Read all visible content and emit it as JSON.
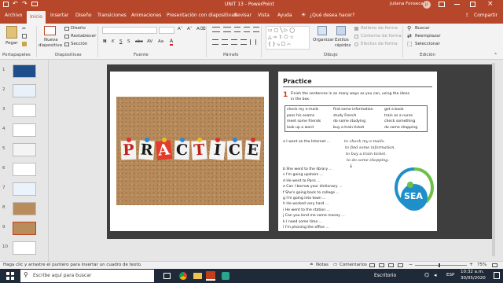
{
  "window": {
    "title": "UNIT 13 - PowerPoint",
    "user": "Juliana Fonseca",
    "user_initials": "JF"
  },
  "tabs": [
    {
      "label": "Archivo"
    },
    {
      "label": "Inicio",
      "active": true
    },
    {
      "label": "Insertar"
    },
    {
      "label": "Diseño"
    },
    {
      "label": "Transiciones"
    },
    {
      "label": "Animaciones"
    },
    {
      "label": "Presentación con diapositivas"
    },
    {
      "label": "Revisar"
    },
    {
      "label": "Vista"
    },
    {
      "label": "Ayuda"
    },
    {
      "label": "¿Qué desea hacer?"
    }
  ],
  "share_label": "Compartir",
  "ribbon": {
    "clipboard": {
      "paste": "Pegar",
      "group": "Portapapeles"
    },
    "slides": {
      "new_slide_1": "Nueva",
      "new_slide_2": "diapositiva",
      "layout": "Diseño",
      "reset": "Restablecer",
      "section": "Sección",
      "group": "Diapositivas"
    },
    "font": {
      "group": "Fuente"
    },
    "paragraph": {
      "group": "Párrafo"
    },
    "drawing": {
      "arrange": "Organizar",
      "quick_styles_1": "Estilos",
      "quick_styles_2": "rápidos",
      "shape_fill": "Relleno de forma",
      "shape_outline": "Contorno de forma",
      "shape_effects": "Efectos de forma",
      "group": "Dibujo"
    },
    "editing": {
      "find": "Buscar",
      "replace": "Reemplazar",
      "select": "Seleccionar",
      "group": "Edición"
    }
  },
  "thumbnails": [
    {
      "number": "1"
    },
    {
      "number": "2"
    },
    {
      "number": "3"
    },
    {
      "number": "4"
    },
    {
      "number": "5"
    },
    {
      "number": "6"
    },
    {
      "number": "7"
    },
    {
      "number": "8"
    },
    {
      "number": "9",
      "selected": true
    },
    {
      "number": "10"
    }
  ],
  "slide": {
    "left_image_word": [
      "P",
      "R",
      "A",
      "C",
      "T",
      "I",
      "C",
      "E"
    ],
    "practice_title": "Practice",
    "exercise_number": "1",
    "instruction_1": "Finish the sentences in as many ways as you can, using the ideas",
    "instruction_2": "in the box.",
    "box": [
      [
        "check my e-mails",
        "find some information",
        "get a book"
      ],
      [
        "pass his exams",
        "study French",
        "train as a nurse"
      ],
      [
        "meet some friends",
        "do some studying",
        "check something"
      ],
      [
        "look up a word",
        "buy a train ticket",
        "do some shopping"
      ]
    ],
    "item_a": "a  I went on the Internet ...",
    "handwriting": [
      "to check my e-mails.",
      "to find some information.",
      "to buy a train ticket.",
      "to do some shopping."
    ],
    "sentences": [
      "b  She went to the library ...",
      "c  I'm going upstairs ...",
      "d  He went to Paris ...",
      "e  Can I borrow your dictionary ...",
      "f  She's going back to college ...",
      "g  I'm going into town ...",
      "h  He worked very hard ...",
      "i  He went to the station ...",
      "j  Can you lend me some money ...",
      "k  I need some time ...",
      "l  I'm phoning the office ..."
    ],
    "logo_text": "SEA"
  },
  "statusbar": {
    "hint": "Haga clic y arrastre el puntero para insertar un cuadro de texto.",
    "notes": "Notas",
    "comments": "Comentarios",
    "zoom": "75%"
  },
  "taskbar": {
    "search_placeholder": "Escribe aquí para buscar",
    "desktop": "Escritorio",
    "language": "ESP",
    "time": "10:32 a.m.",
    "date": "30/05/2020"
  },
  "colors": {
    "brand": "#b7472a",
    "taskbar": "#1f2a38",
    "accent_red": "#c43e1c",
    "logo_blue": "#1e8fc9",
    "logo_green": "#6cc04a"
  }
}
